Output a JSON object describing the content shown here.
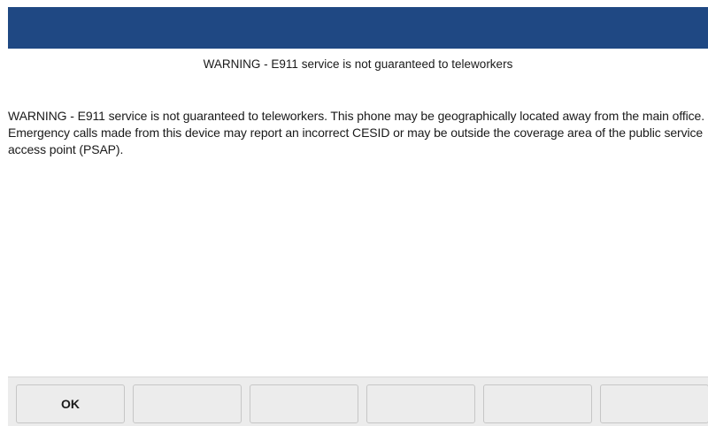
{
  "dialog": {
    "header": "WARNING - E911 service is not guaranteed to teleworkers",
    "body": "WARNING - E911 service is not guaranteed to teleworkers. This phone may be geographically located away from the main office. Emergency calls made from this device may report an incorrect CESID or may be outside the coverage area of the public service access point (PSAP)."
  },
  "softkeys": [
    {
      "label": "OK"
    },
    {
      "label": ""
    },
    {
      "label": ""
    },
    {
      "label": ""
    },
    {
      "label": ""
    },
    {
      "label": ""
    }
  ],
  "colors": {
    "title_bar": "#1f4883",
    "softkey_bar": "#ececec",
    "text": "#1a1a1a"
  }
}
